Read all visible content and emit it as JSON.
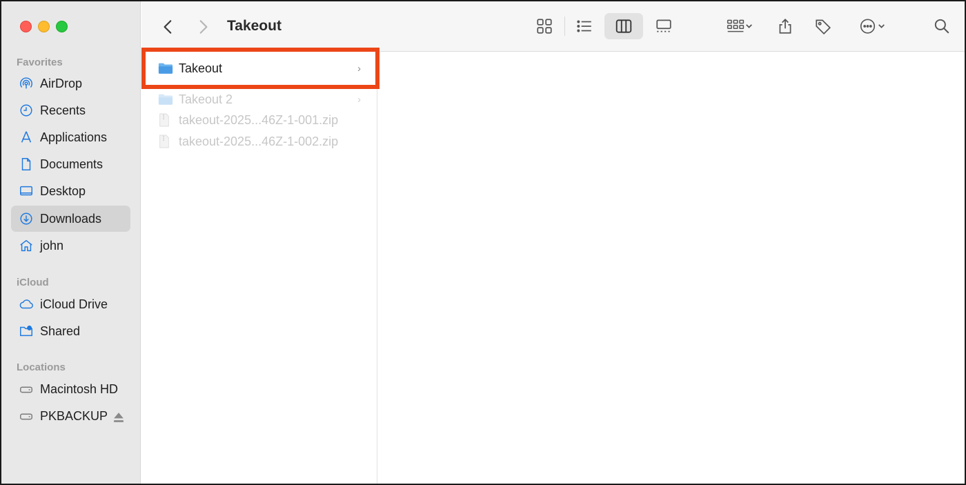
{
  "window": {
    "path_title": "Takeout"
  },
  "sidebar": {
    "favorites_title": "Favorites",
    "favorites": [
      {
        "label": "AirDrop",
        "icon": "airdrop-icon"
      },
      {
        "label": "Recents",
        "icon": "clock-icon"
      },
      {
        "label": "Applications",
        "icon": "applications-icon"
      },
      {
        "label": "Documents",
        "icon": "document-icon"
      },
      {
        "label": "Desktop",
        "icon": "desktop-icon"
      },
      {
        "label": "Downloads",
        "icon": "downloads-icon",
        "selected": true
      },
      {
        "label": "john",
        "icon": "home-icon"
      }
    ],
    "icloud_title": "iCloud",
    "icloud": [
      {
        "label": "iCloud Drive",
        "icon": "cloud-icon"
      },
      {
        "label": "Shared",
        "icon": "shared-folder-icon"
      }
    ],
    "locations_title": "Locations",
    "locations": [
      {
        "label": "Macintosh HD",
        "icon": "drive-icon"
      },
      {
        "label": "PKBACKUP",
        "icon": "drive-icon",
        "ejectable": true
      }
    ]
  },
  "column1": {
    "items": [
      {
        "label": "Takeout",
        "type": "folder",
        "highlighted": true,
        "has_children": true
      },
      {
        "label": "Takeout 2",
        "type": "folder",
        "dimmed": true,
        "has_children": true
      },
      {
        "label": "takeout-2025...46Z-1-001.zip",
        "type": "zip",
        "dimmed": true
      },
      {
        "label": "takeout-2025...46Z-1-002.zip",
        "type": "zip",
        "dimmed": true
      }
    ],
    "chevron": "›"
  },
  "colors": {
    "accent_icon": "#1f7ae0",
    "highlight_border": "#ec4617",
    "folder_blue": "#6cb4ee"
  }
}
